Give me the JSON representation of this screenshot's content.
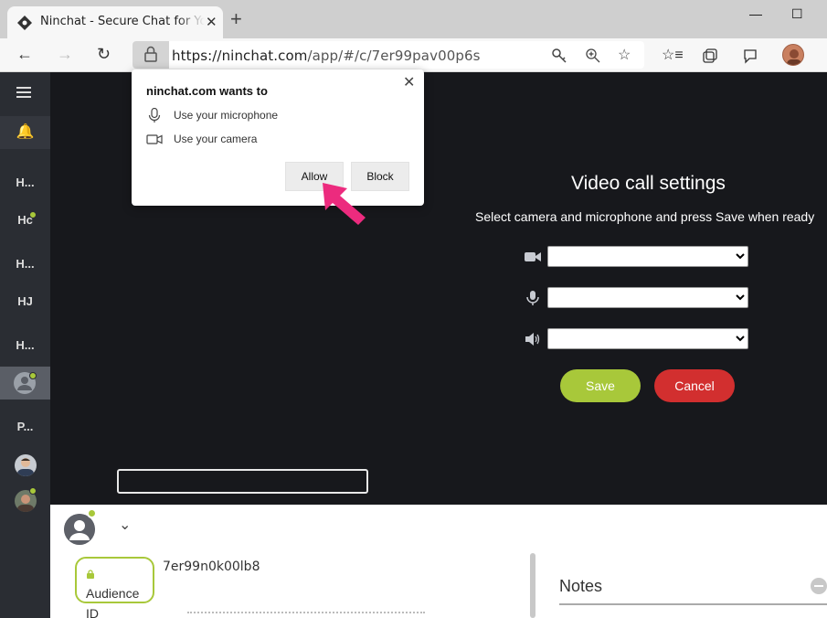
{
  "browser": {
    "tab_title": "Ninchat - Secure Chat for Your Business",
    "tab_close": "✕",
    "new_tab": "+",
    "url_host": "https://ninchat.com",
    "url_path": "/app/#/c/7er99pav00p6s"
  },
  "permission": {
    "title": "ninchat.com wants to",
    "items": [
      {
        "icon": "microphone-icon",
        "label": "Use your microphone"
      },
      {
        "icon": "camera-icon",
        "label": "Use your camera"
      }
    ],
    "allow_label": "Allow",
    "block_label": "Block",
    "close": "✕"
  },
  "sidebar": {
    "items": [
      {
        "label": "H..."
      },
      {
        "label": "Hc",
        "online": true
      },
      {
        "label": "H..."
      },
      {
        "label": "HJ"
      },
      {
        "label": "H..."
      },
      {
        "label": "P..."
      }
    ]
  },
  "video_settings": {
    "title": "Video call settings",
    "subtitle": "Select camera and microphone and press Save when ready",
    "camera_icon": "video-camera-icon",
    "mic_icon": "microphone-icon",
    "speaker_icon": "speaker-icon",
    "save_label": "Save",
    "cancel_label": "Cancel"
  },
  "lower": {
    "badge_text": "Audience ID",
    "audience_id": "7er99n0k00lb8",
    "notes_title": "Notes"
  },
  "colors": {
    "accent_green": "#a8c83a",
    "cancel_red": "#d22f2f",
    "sidebar_bg": "#2a2d33",
    "video_bg": "#17181c",
    "arrow_pink": "#ec2b7e"
  }
}
